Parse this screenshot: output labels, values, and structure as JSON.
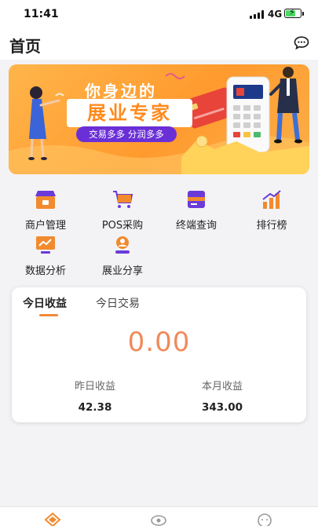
{
  "status": {
    "time": "11:41",
    "network": "4G",
    "battery_level": 0.58
  },
  "header": {
    "title": "首页",
    "message_icon": "chat-bubble-icon"
  },
  "banner": {
    "headline": "你身边的",
    "big_text": "展业专家",
    "pill_text": "交易多多  分润多多"
  },
  "quick_actions": [
    {
      "label": "商户管理",
      "icon": "storefront-icon",
      "color": "#f28a2e"
    },
    {
      "label": "POS采购",
      "icon": "shopping-cart-icon",
      "color": "#f28a2e"
    },
    {
      "label": "终端查询",
      "icon": "terminal-card-icon",
      "color": "#6a3bd9"
    },
    {
      "label": "排行榜",
      "icon": "ranking-chart-icon",
      "color": "#f28a2e"
    },
    {
      "label": "数据分析",
      "icon": "analytics-board-icon",
      "color": "#f28a2e"
    },
    {
      "label": "展业分享",
      "icon": "share-person-icon",
      "color": "#f28a2e"
    }
  ],
  "earnings": {
    "tabs": [
      "今日收益",
      "今日交易"
    ],
    "active_tab": 0,
    "total": "0.00",
    "yesterday_label": "昨日收益",
    "yesterday_value": "42.38",
    "month_label": "本月收益",
    "month_value": "343.00"
  },
  "bottom_nav": [
    {
      "icon": "home-diamond-icon",
      "active": true
    },
    {
      "icon": "eye-icon",
      "active": false
    },
    {
      "icon": "profile-face-icon",
      "active": false
    }
  ],
  "colors": {
    "accent": "#f28a2e",
    "purple": "#6a3bd9",
    "total_value": "#f08a5a"
  }
}
